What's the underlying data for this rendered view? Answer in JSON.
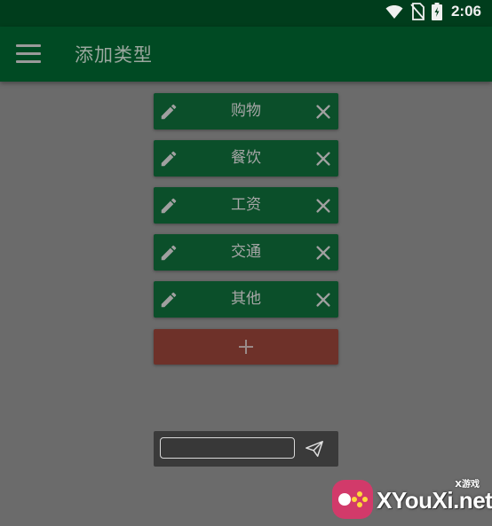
{
  "status_bar": {
    "time": "2:06",
    "icons": [
      "wifi-icon",
      "no-sim-icon",
      "battery-charging-icon"
    ]
  },
  "app_bar": {
    "title": "添加类型",
    "menu_icon": "hamburger-menu-icon"
  },
  "type_list": {
    "items": [
      {
        "label": "购物",
        "edit_icon": "pencil-icon",
        "delete_icon": "close-icon"
      },
      {
        "label": "餐饮",
        "edit_icon": "pencil-icon",
        "delete_icon": "close-icon"
      },
      {
        "label": "工资",
        "edit_icon": "pencil-icon",
        "delete_icon": "close-icon"
      },
      {
        "label": "交通",
        "edit_icon": "pencil-icon",
        "delete_icon": "close-icon"
      },
      {
        "label": "其他",
        "edit_icon": "pencil-icon",
        "delete_icon": "close-icon"
      }
    ],
    "add_icon": "plus-icon"
  },
  "input_bar": {
    "value": "",
    "placeholder": "",
    "send_icon": "paper-plane-icon"
  },
  "watermark": {
    "brand": "XYouXi.net",
    "sub": "X游戏"
  },
  "colors": {
    "status_bar": "#003d1c",
    "app_bar": "#004a23",
    "item_bg": "#0b4f2a",
    "add_button": "#6e3129",
    "overlay": "#6b6b6b"
  }
}
